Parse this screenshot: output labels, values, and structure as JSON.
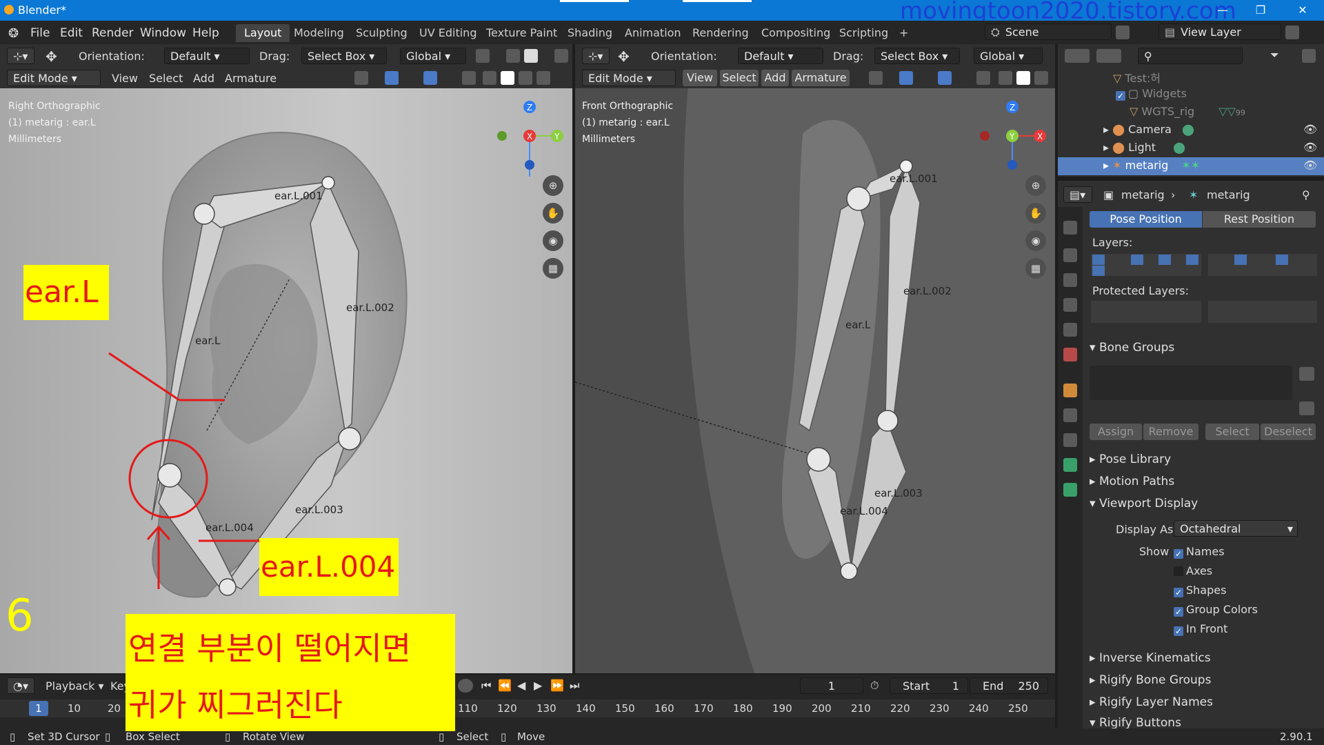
{
  "window": {
    "title": "Blender*",
    "watermark": "movingtoon2020.tistory.com"
  },
  "menu": [
    "File",
    "Edit",
    "Render",
    "Window",
    "Help"
  ],
  "workspaces": [
    "Layout",
    "Modeling",
    "Sculpting",
    "UV Editing",
    "Texture Paint",
    "Shading",
    "Animation",
    "Rendering",
    "Compositing",
    "Scripting"
  ],
  "active_workspace": "Layout",
  "scene": {
    "name": "Scene",
    "view_layer": "View Layer"
  },
  "viewport_header": {
    "orientation_label": "Orientation:",
    "orientation_value": "Default",
    "drag_label": "Drag:",
    "drag_value": "Select Box",
    "transform": "Global",
    "mode": "Edit Mode",
    "menus": [
      "View",
      "Select",
      "Add",
      "Armature"
    ]
  },
  "left_viewport": {
    "view": "Right Orthographic",
    "object": "(1) metarig : ear.L",
    "units": "Millimeters",
    "bones": [
      "ear.L",
      "ear.L.001",
      "ear.L.002",
      "ear.L.003",
      "ear.L.004"
    ]
  },
  "right_viewport": {
    "view": "Front Orthographic",
    "object": "(1) metarig : ear.L",
    "units": "Millimeters",
    "bones": [
      "ear.L",
      "ear.L.001",
      "ear.L.002",
      "ear.L.003",
      "ear.L.004"
    ]
  },
  "gizmo": {
    "z": "Z",
    "y": "Y",
    "x": "X"
  },
  "outliner": {
    "items": [
      {
        "name": "Test:허",
        "dim": true
      },
      {
        "name": "Widgets",
        "dim": true
      },
      {
        "name": "WGTS_rig",
        "dim": true
      },
      {
        "name": "Camera",
        "dim": false
      },
      {
        "name": "Light",
        "dim": false
      },
      {
        "name": "metarig",
        "dim": false,
        "selected": true
      }
    ],
    "badge": "99"
  },
  "properties": {
    "breadcrumb_object": "metarig",
    "breadcrumb_data": "metarig",
    "pose_position": "Pose Position",
    "rest_position": "Rest Position",
    "layers_label": "Layers:",
    "protected_layers_label": "Protected Layers:",
    "bone_groups": "Bone Groups",
    "bone_group_buttons": [
      "Assign",
      "Remove",
      "Select",
      "Deselect"
    ],
    "pose_library": "Pose Library",
    "motion_paths": "Motion Paths",
    "viewport_display": "Viewport Display",
    "display_as_label": "Display As",
    "display_as_value": "Octahedral",
    "show_label": "Show",
    "show_options": [
      {
        "label": "Names",
        "checked": true
      },
      {
        "label": "Axes",
        "checked": false
      },
      {
        "label": "Shapes",
        "checked": true
      },
      {
        "label": "Group Colors",
        "checked": true
      },
      {
        "label": "In Front",
        "checked": true
      }
    ],
    "collapsed_panels": [
      "Inverse Kinematics",
      "Rigify Bone Groups",
      "Rigify Layer Names",
      "Rigify Buttons"
    ]
  },
  "timeline": {
    "playback": "Playback",
    "keying": "Key",
    "current_frame": "1",
    "start_label": "Start",
    "start_value": "1",
    "end_label": "End",
    "end_value": "250",
    "ruler": [
      "1",
      "10",
      "20",
      "110",
      "120",
      "130",
      "140",
      "150",
      "160",
      "170",
      "180",
      "190",
      "200",
      "210",
      "220",
      "230",
      "240",
      "250"
    ]
  },
  "statusbar": {
    "items": [
      "Set 3D Cursor",
      "Box Select",
      "Rotate View",
      "Select",
      "Move"
    ],
    "version": "2.90.1"
  },
  "annotations": {
    "label_ear": "ear.L",
    "label_ear004": "ear.L.004",
    "step_number": "6",
    "warning_line1": "연결 부분이 떨어지면",
    "warning_line2": "귀가 찌그러진다"
  },
  "colors": {
    "accent": "#4772b3",
    "annotation_yellow": "#ffff00",
    "annotation_red": "#e41919",
    "title_blue": "#0a78d4"
  }
}
